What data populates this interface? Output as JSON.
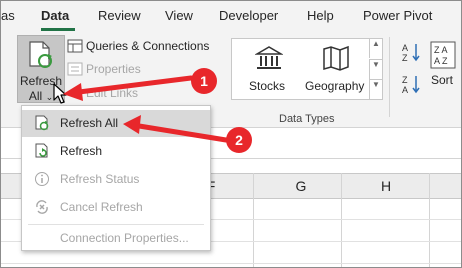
{
  "tabs": [
    {
      "label": "as"
    },
    {
      "label": "Data"
    },
    {
      "label": "Review"
    },
    {
      "label": "View"
    },
    {
      "label": "Developer"
    },
    {
      "label": "Help"
    },
    {
      "label": "Power Pivot"
    }
  ],
  "ribbon": {
    "refresh_all_line1": "Refresh",
    "refresh_all_line2": "All",
    "queries_connections": "Queries & Connections",
    "properties": "Properties",
    "edit_links": "Edit Links",
    "stocks": "Stocks",
    "geography": "Geography",
    "data_types_caption": "Data Types",
    "sort": "Sort"
  },
  "columns": [
    "F",
    "G",
    "H"
  ],
  "menu": {
    "items": [
      {
        "label": "Refresh All",
        "enabled": true
      },
      {
        "label": "Refresh",
        "enabled": true
      },
      {
        "label": "Refresh Status",
        "enabled": false
      },
      {
        "label": "Cancel Refresh",
        "enabled": false
      },
      {
        "label": "Connection Properties...",
        "enabled": false
      }
    ]
  },
  "annotations": {
    "badge1": "1",
    "badge2": "2"
  },
  "colors": {
    "accent_green": "#217346",
    "annotation_red": "#e8272b",
    "refresh_green": "#3a9a3f"
  }
}
